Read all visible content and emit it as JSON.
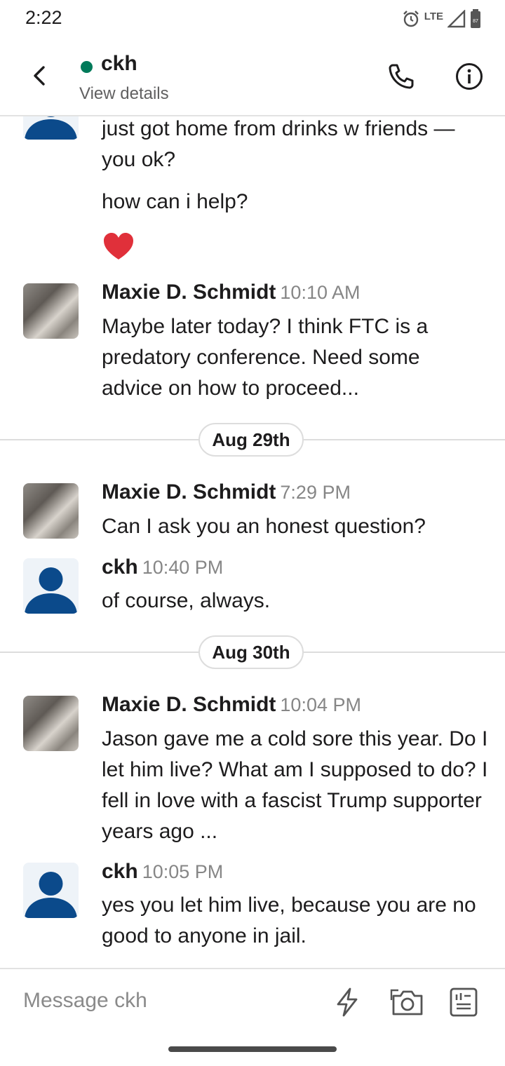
{
  "status_bar": {
    "time": "2:22",
    "network": "LTE",
    "battery": "87"
  },
  "header": {
    "title": "ckh",
    "subtitle": "View details",
    "presence_color": "#007a5a"
  },
  "messages": [
    {
      "text": "just got home from drinks w friends — you ok?"
    },
    {
      "text": "how can i help?"
    },
    {
      "emoji": "❤️"
    },
    {
      "author": "Maxie D. Schmidt",
      "time": "10:10 AM",
      "text": "Maybe later today? I think FTC is a predatory conference. Need some advice on how to proceed..."
    },
    {
      "author": "Maxie D. Schmidt",
      "time": "7:29 PM",
      "text": "Can I ask you an honest question?"
    },
    {
      "author": "ckh",
      "time": "10:40 PM",
      "text": "of course, always."
    },
    {
      "author": "Maxie D. Schmidt",
      "time": "10:04 PM",
      "text": "Jason gave me a cold sore this year. Do I let him live? What am I supposed to do? I fell in love with a fascist Trump supporter years ago ..."
    },
    {
      "author": "ckh",
      "time": "10:05 PM",
      "text": "yes you let him live, because you are no good to anyone in jail."
    }
  ],
  "date_dividers": [
    "Aug 29th",
    "Aug 30th"
  ],
  "composer": {
    "placeholder": "Message ckh"
  },
  "colors": {
    "avatar_blue": "#0b4a8b",
    "heart_red": "#e0303a"
  }
}
